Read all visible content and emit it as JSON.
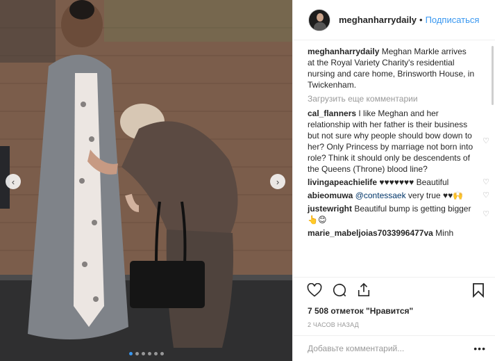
{
  "post": {
    "username": "meghanharrydaily",
    "separator": "•",
    "follow_label": "Подписаться",
    "caption_user": "meghanharrydaily",
    "caption_text": "Meghan Markle arrives at the Royal Variety Charity's residential nursing and care home, Brinsworth House, in Twickenham.",
    "load_more_label": "Загрузить еще комментарии",
    "likes_text": "7 508 отметок \"Нравится\"",
    "time_text": "2 ЧАСОВ НАЗАД",
    "comment_placeholder": "Добавьте комментарий...",
    "more_label": "•••"
  },
  "comments": [
    {
      "user": "cal_flanners",
      "text": "I like Meghan and her relationship with her father is their business but not sure why people should bow down to her? Only Princess by marriage not born into role? Think it should only be descendents of the Queens (Throne) blood line?"
    },
    {
      "user": "livingapeachielife",
      "text": "♥♥♥♥♥♥♥ Beautiful"
    },
    {
      "user": "abieomuwa",
      "mention": "@contessaek",
      "text": " very true ♥♥🙌"
    },
    {
      "user": "justewright",
      "text": "Beautiful bump is getting bigger👆😊"
    },
    {
      "user": "marie_mabeljoias7033996477va",
      "text": "Minh"
    }
  ],
  "icons": {
    "like": "heart-icon",
    "comment": "comment-icon",
    "share": "share-icon",
    "save": "bookmark-icon",
    "prev": "chevron-left-icon",
    "next": "chevron-right-icon"
  },
  "carousel": {
    "total": 6,
    "active_index": 0
  },
  "colors": {
    "accent": "#3897f0",
    "text": "#262626",
    "muted": "#999999"
  }
}
